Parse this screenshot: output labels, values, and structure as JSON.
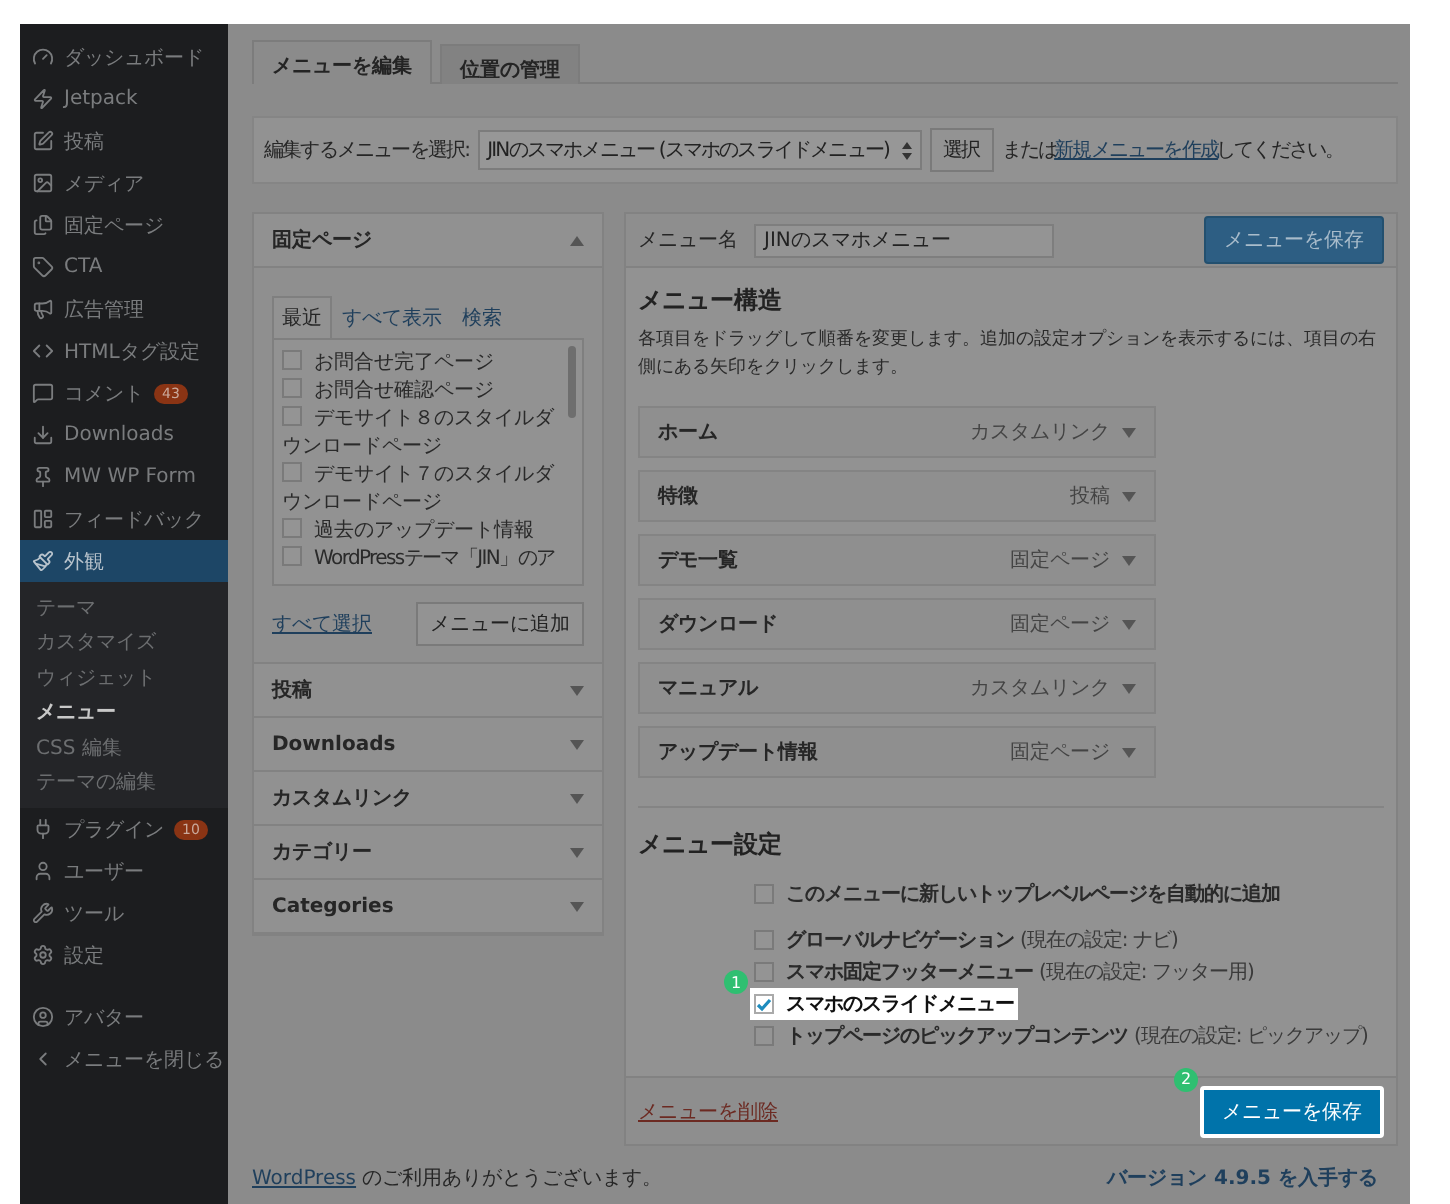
{
  "sidebar": {
    "items": [
      {
        "label": "ダッシュボード",
        "selected": false
      },
      {
        "label": "Jetpack",
        "selected": false
      },
      {
        "label": "投稿",
        "selected": false
      },
      {
        "label": "メディア",
        "selected": false
      },
      {
        "label": "固定ページ",
        "selected": false
      },
      {
        "label": "CTA",
        "selected": false
      },
      {
        "label": "広告管理",
        "selected": false
      },
      {
        "label": "HTMLタグ設定",
        "selected": false
      },
      {
        "label": "コメント",
        "badge": "43",
        "selected": false
      },
      {
        "label": "Downloads",
        "selected": false
      },
      {
        "label": "MW WP Form",
        "selected": false
      },
      {
        "label": "フィードバック",
        "selected": false
      },
      {
        "label": "外観",
        "selected": true,
        "children": [
          {
            "label": "テーマ",
            "selected": false
          },
          {
            "label": "カスタマイズ",
            "selected": false
          },
          {
            "label": "ウィジェット",
            "selected": false
          },
          {
            "label": "メニュー",
            "selected": true
          },
          {
            "label": "CSS 編集",
            "selected": false
          },
          {
            "label": "テーマの編集",
            "selected": false
          }
        ]
      },
      {
        "label": "プラグイン",
        "badge": "10",
        "selected": false
      },
      {
        "label": "ユーザー",
        "selected": false
      },
      {
        "label": "ツール",
        "selected": false
      },
      {
        "label": "設定",
        "selected": false
      },
      {
        "label": "アバター",
        "selected": false
      },
      {
        "label": "メニューを閉じる",
        "selected": false
      }
    ]
  },
  "tabs": [
    {
      "label": "メニューを編集",
      "selected": true
    },
    {
      "label": "位置の管理",
      "selected": false
    }
  ],
  "menu_select": {
    "label": "編集するメニューを選択:",
    "value": "JINのスマホメニュー (スマホのスライドメニュー)",
    "button": "選択",
    "text_before": "または",
    "link": "新規メニューを作成",
    "text_after": "してください。"
  },
  "add_items": {
    "sections": [
      {
        "title": "固定ページ",
        "expanded": true,
        "subtabs": [
          {
            "label": "最近",
            "selected": true
          },
          {
            "label": "すべて表示",
            "selected": false
          },
          {
            "label": "検索",
            "selected": false
          }
        ],
        "items": [
          {
            "label": "お問合せ完了ページ",
            "checked": false
          },
          {
            "label": "お問合せ確認ページ",
            "checked": false
          },
          {
            "label": "デモサイト８のスタイルダウンロードページ",
            "checked": false
          },
          {
            "label": "デモサイト７のスタイルダウンロードページ",
            "checked": false
          },
          {
            "label": "過去のアップデート情報",
            "checked": false
          },
          {
            "label": "WordPressテーマ「JIN」のア",
            "checked": false
          }
        ],
        "select_all": "すべて選択",
        "add_button": "メニューに追加"
      },
      {
        "title": "投稿",
        "expanded": false
      },
      {
        "title": "Downloads",
        "expanded": false
      },
      {
        "title": "カスタムリンク",
        "expanded": false
      },
      {
        "title": "カテゴリー",
        "expanded": false
      },
      {
        "title": "Categories",
        "expanded": false
      }
    ]
  },
  "menu_editor": {
    "name_label": "メニュー名",
    "name_value": "JINのスマホメニュー",
    "save_button": "メニューを保存",
    "structure_title": "メニュー構造",
    "structure_help": "各項目をドラッグして順番を変更します。追加の設定オプションを表示するには、項目の右側にある矢印をクリックします。",
    "items": [
      {
        "title": "ホーム",
        "item_type": "カスタムリンク"
      },
      {
        "title": "特徴",
        "item_type": "投稿"
      },
      {
        "title": "デモ一覧",
        "item_type": "固定ページ"
      },
      {
        "title": "ダウンロード",
        "item_type": "固定ページ"
      },
      {
        "title": "マニュアル",
        "item_type": "カスタムリンク"
      },
      {
        "title": "アップデート情報",
        "item_type": "固定ページ"
      }
    ],
    "settings_title": "メニュー設定",
    "auto_add": {
      "label": "このメニューに新しいトップレベルページを自動的に追加",
      "checked": false
    },
    "locations": [
      {
        "label": "グローバルナビゲーション",
        "note": "(現在の設定: ナビ)",
        "checked": false,
        "highlighted": false
      },
      {
        "label": "スマホ固定フッターメニュー",
        "note": "(現在の設定: フッター用)",
        "checked": false,
        "highlighted": false
      },
      {
        "label": "スマホのスライドメニュー",
        "checked": true,
        "highlighted": true,
        "marker": "1"
      },
      {
        "label": "トップページのピックアップコンテンツ",
        "note": "(現在の設定: ピックアップ)",
        "checked": false,
        "highlighted": false
      }
    ],
    "delete_link": "メニューを削除",
    "footer_save": {
      "label": "メニューを保存",
      "highlighted": true,
      "marker": "2"
    }
  },
  "footer": {
    "thanks_link": "WordPress",
    "thanks_text": "のご利用ありがとうございます。",
    "version_link": "バージョン 4.9.5 を入手する"
  }
}
